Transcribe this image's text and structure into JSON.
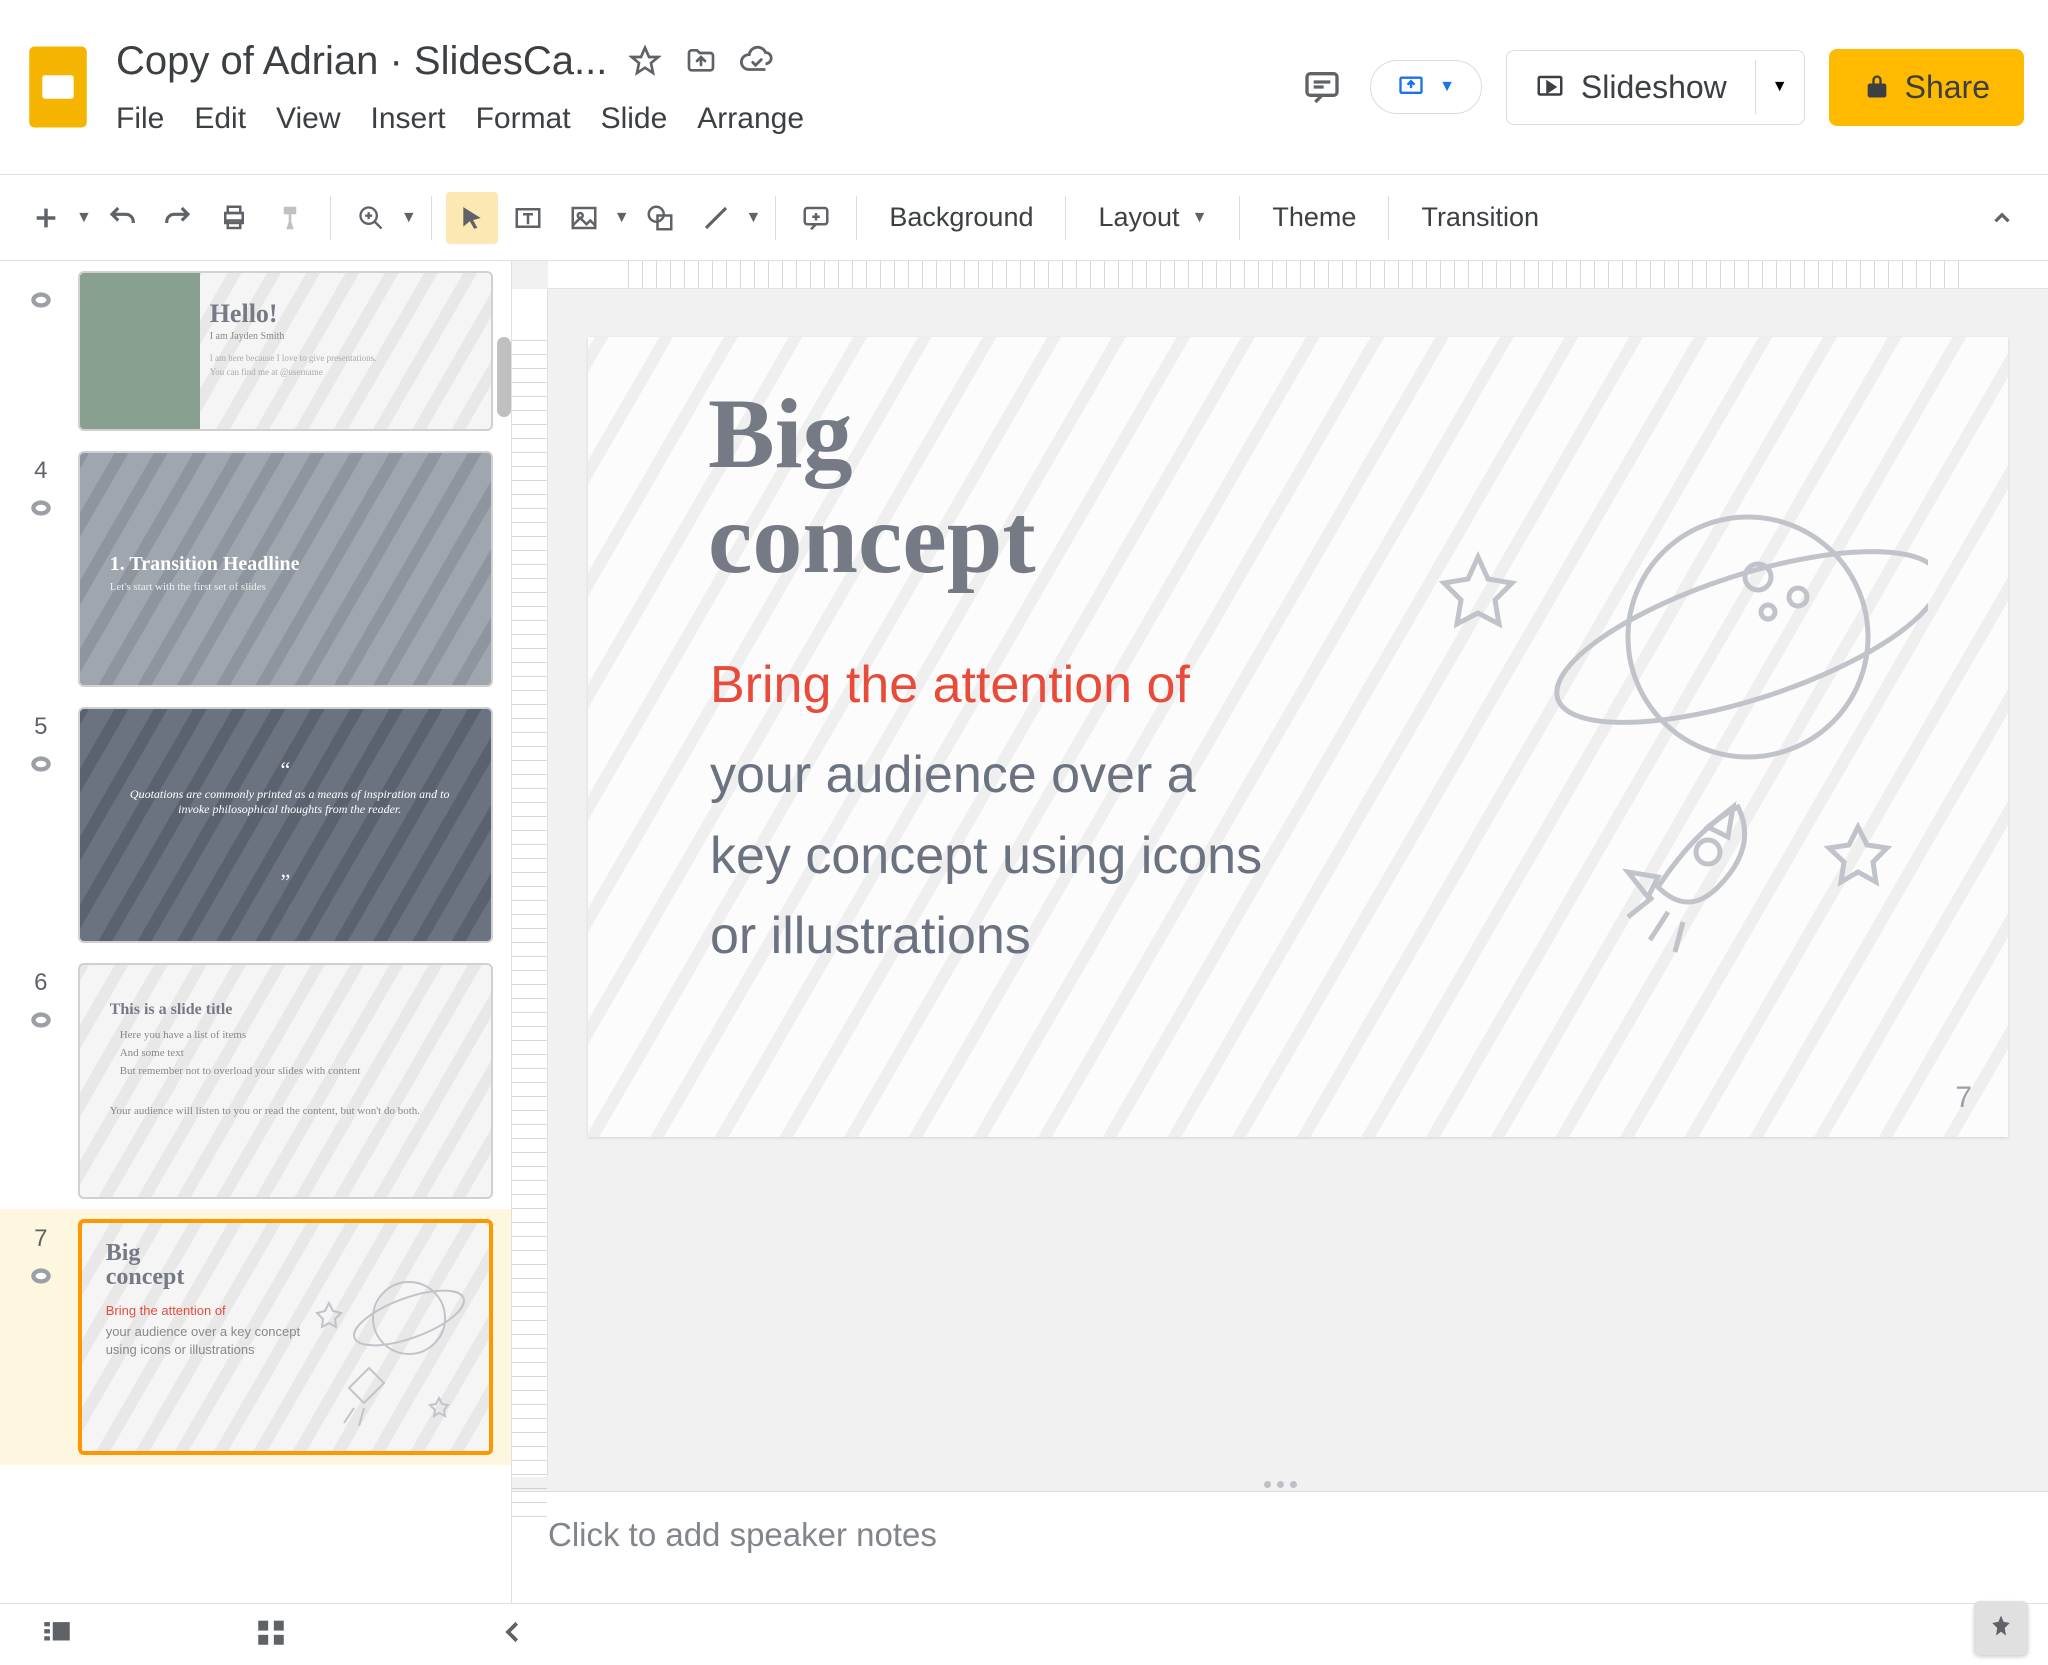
{
  "header": {
    "title": "Copy of Adrian · SlidesCa...",
    "menus": [
      "File",
      "Edit",
      "View",
      "Insert",
      "Format",
      "Slide",
      "Arrange"
    ],
    "slideshow_label": "Slideshow",
    "share_label": "Share"
  },
  "toolbar": {
    "background": "Background",
    "layout": "Layout",
    "theme": "Theme",
    "transition": "Transition"
  },
  "sidebar": {
    "thumbs": [
      {
        "num": "",
        "type": "hello",
        "title": "Hello!",
        "sub1": "I am Jayden Smith",
        "sub2": "I am here because I love to give presentations.",
        "sub3": "You can find me at @username"
      },
      {
        "num": "4",
        "type": "grey",
        "title": "1. Transition Headline",
        "sub": "Let's start with the first set of slides"
      },
      {
        "num": "5",
        "type": "dark",
        "quote": "Quotations are commonly printed as a means of inspiration and to invoke philosophical thoughts from the reader."
      },
      {
        "num": "6",
        "type": "light",
        "title": "This is a slide title",
        "l1": "Here you have a list of items",
        "l2": "And some text",
        "l3": "But remember not to overload your slides with content",
        "l4": "Your audience will listen to you or read the content, but won't do both."
      },
      {
        "num": "7",
        "type": "concept",
        "title": "Big concept",
        "red": "Bring the attention of",
        "body": "your audience over a key concept using icons or illustrations",
        "selected": true
      }
    ]
  },
  "slide": {
    "title_l1": "Big",
    "title_l2": "concept",
    "red": "Bring the attention of",
    "body_l1": "your audience over a",
    "body_l2": "key concept using icons",
    "body_l3": "or illustrations",
    "page_num": "7"
  },
  "notes": {
    "placeholder": "Click to add speaker notes"
  }
}
